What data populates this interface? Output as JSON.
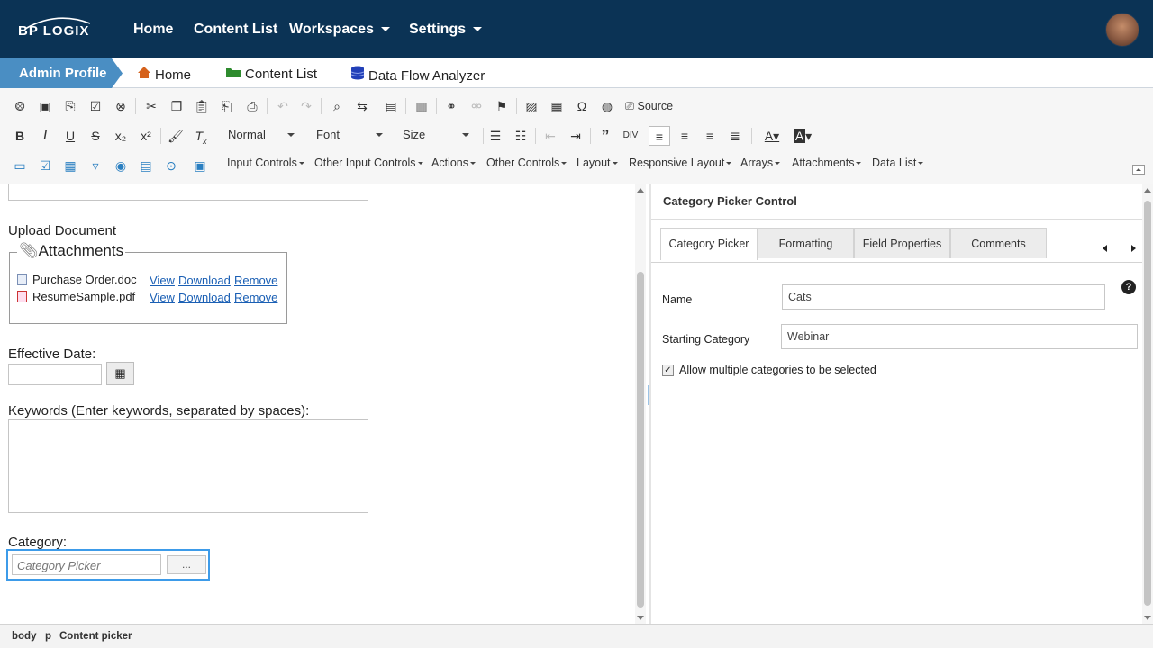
{
  "topnav": {
    "logo": "BP LOGIX",
    "items": [
      {
        "label": "Home",
        "dropdown": false
      },
      {
        "label": "Content List",
        "dropdown": false
      },
      {
        "label": "Workspaces",
        "dropdown": true
      },
      {
        "label": "Settings",
        "dropdown": true
      }
    ],
    "bg_color": "#0b3355"
  },
  "subnav": {
    "active": "Admin Profile",
    "items": [
      {
        "label": "Home",
        "icon": "house-icon"
      },
      {
        "label": "Content List",
        "icon": "folder-icon"
      },
      {
        "label": "Data Flow Analyzer",
        "icon": "database-icon"
      }
    ],
    "accent": "#4a8ec3"
  },
  "toolbar": {
    "source_label": "Source",
    "format_combo": "Normal",
    "font_combo": "Font",
    "size_combo": "Size",
    "menus": [
      "Input Controls",
      "Other Input Controls",
      "Actions",
      "Other Controls",
      "Layout",
      "Responsive Layout",
      "Arrays",
      "Attachments",
      "Data List"
    ]
  },
  "editor": {
    "upload_label": "Upload Document",
    "attachments_legend": "Attachments",
    "attachments": [
      {
        "name": "Purchase Order.doc",
        "type": "doc"
      },
      {
        "name": "ResumeSample.pdf",
        "type": "pdf"
      }
    ],
    "attachment_links": {
      "view": "View",
      "download": "Download",
      "remove": "Remove"
    },
    "effective_date_label": "Effective Date:",
    "keywords_label": "Keywords (Enter keywords, separated by spaces):",
    "category_label": "Category:",
    "category_placeholder": "Category Picker",
    "category_button": "..."
  },
  "panel": {
    "title": "Category Picker Control",
    "tabs": [
      "Category Picker",
      "Formatting",
      "Field Properties",
      "Comments"
    ],
    "active_tab": "Category Picker",
    "name_label": "Name",
    "name_value": "Cats",
    "starting_label": "Starting Category",
    "starting_value": "Webinar",
    "allow_multiple_label": "Allow multiple categories to be selected",
    "allow_multiple_checked": true,
    "help": "?"
  },
  "statusbar": {
    "path": [
      "body",
      "p",
      "Content picker"
    ]
  }
}
